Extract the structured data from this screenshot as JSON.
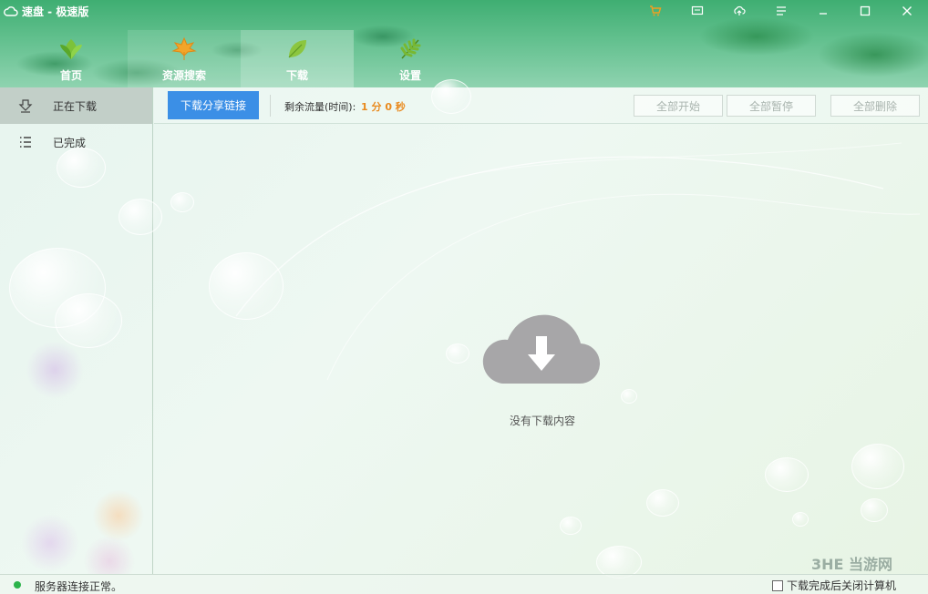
{
  "window": {
    "title": "速盘 - 极速版",
    "controls": [
      "cart-icon",
      "message-icon",
      "upload-cloud-icon",
      "menu-icon",
      "minimize-icon",
      "maximize-icon",
      "close-icon"
    ],
    "accent_color": "#3fae72",
    "cart_color": "#f0a020"
  },
  "tabs": [
    {
      "label": "首页",
      "icon": "leaf-icon",
      "active": false
    },
    {
      "label": "资源搜索",
      "icon": "maple-leaf-icon",
      "active": false
    },
    {
      "label": "下载",
      "icon": "green-leaf-icon",
      "active": true
    },
    {
      "label": "设置",
      "icon": "fern-leaf-icon",
      "active": false
    }
  ],
  "sidebar": {
    "items": [
      {
        "label": "正在下载",
        "icon": "download-arrow-icon",
        "active": true
      },
      {
        "label": "已完成",
        "icon": "list-icon",
        "active": false
      }
    ]
  },
  "toolbar": {
    "share_link_label": "下载分享链接",
    "share_link_color": "#3b8fe6",
    "traffic_label": "剩余流量(时间):",
    "traffic_value": "1 分 0 秒",
    "traffic_value_color": "#e98a1e",
    "start_all_label": "全部开始",
    "pause_all_label": "全部暂停",
    "delete_all_label": "全部删除"
  },
  "main": {
    "empty_icon": "cloud-download-icon",
    "empty_text": "没有下载内容"
  },
  "statusbar": {
    "status_text": "服务器连接正常。",
    "status_color": "#2bb34a",
    "shutdown_label": "下载完成后关闭计算机",
    "shutdown_checked": false
  },
  "watermark": "3HE 当游网"
}
